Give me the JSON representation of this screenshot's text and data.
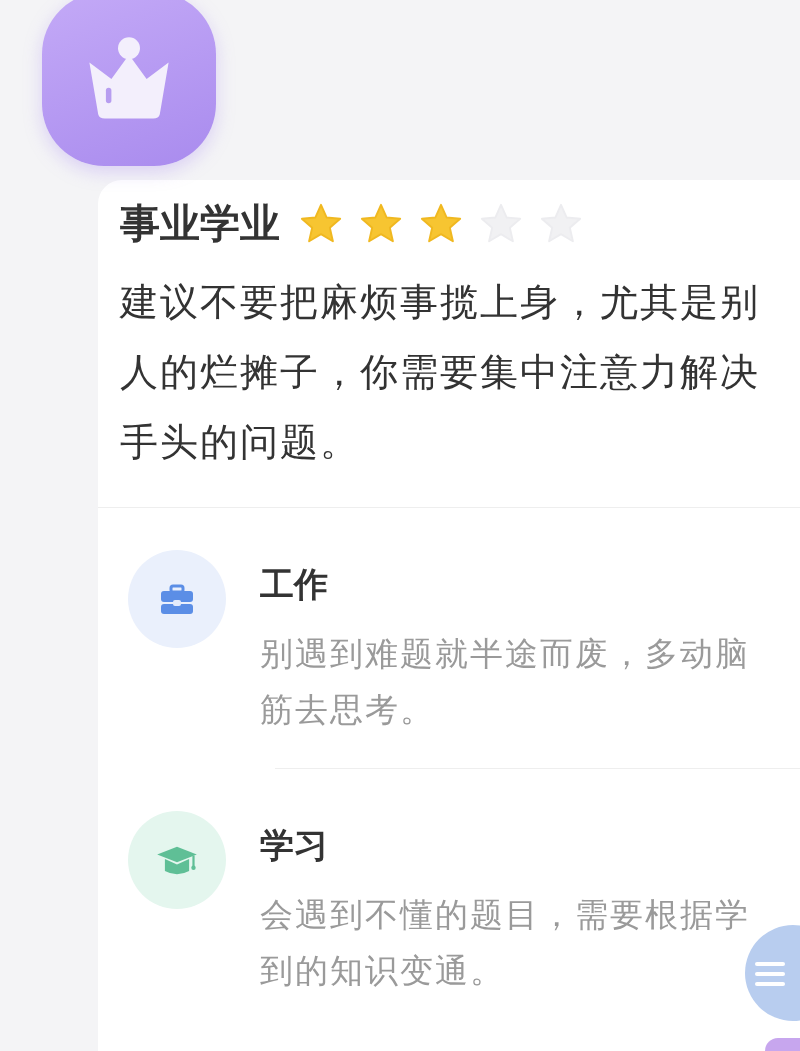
{
  "career": {
    "title": "事业学业",
    "stars": 3,
    "summary": "建议不要把麻烦事揽上身，尤其是别人的烂摊子，你需要集中注意力解决手头的问题。"
  },
  "items": [
    {
      "kind": "work",
      "title": "工作",
      "text": "别遇到难题就半途而废，多动脑筋去思考。"
    },
    {
      "kind": "study",
      "title": "学习",
      "text": "会遇到不懂的题目，需要根据学到的知识变通。"
    }
  ]
}
